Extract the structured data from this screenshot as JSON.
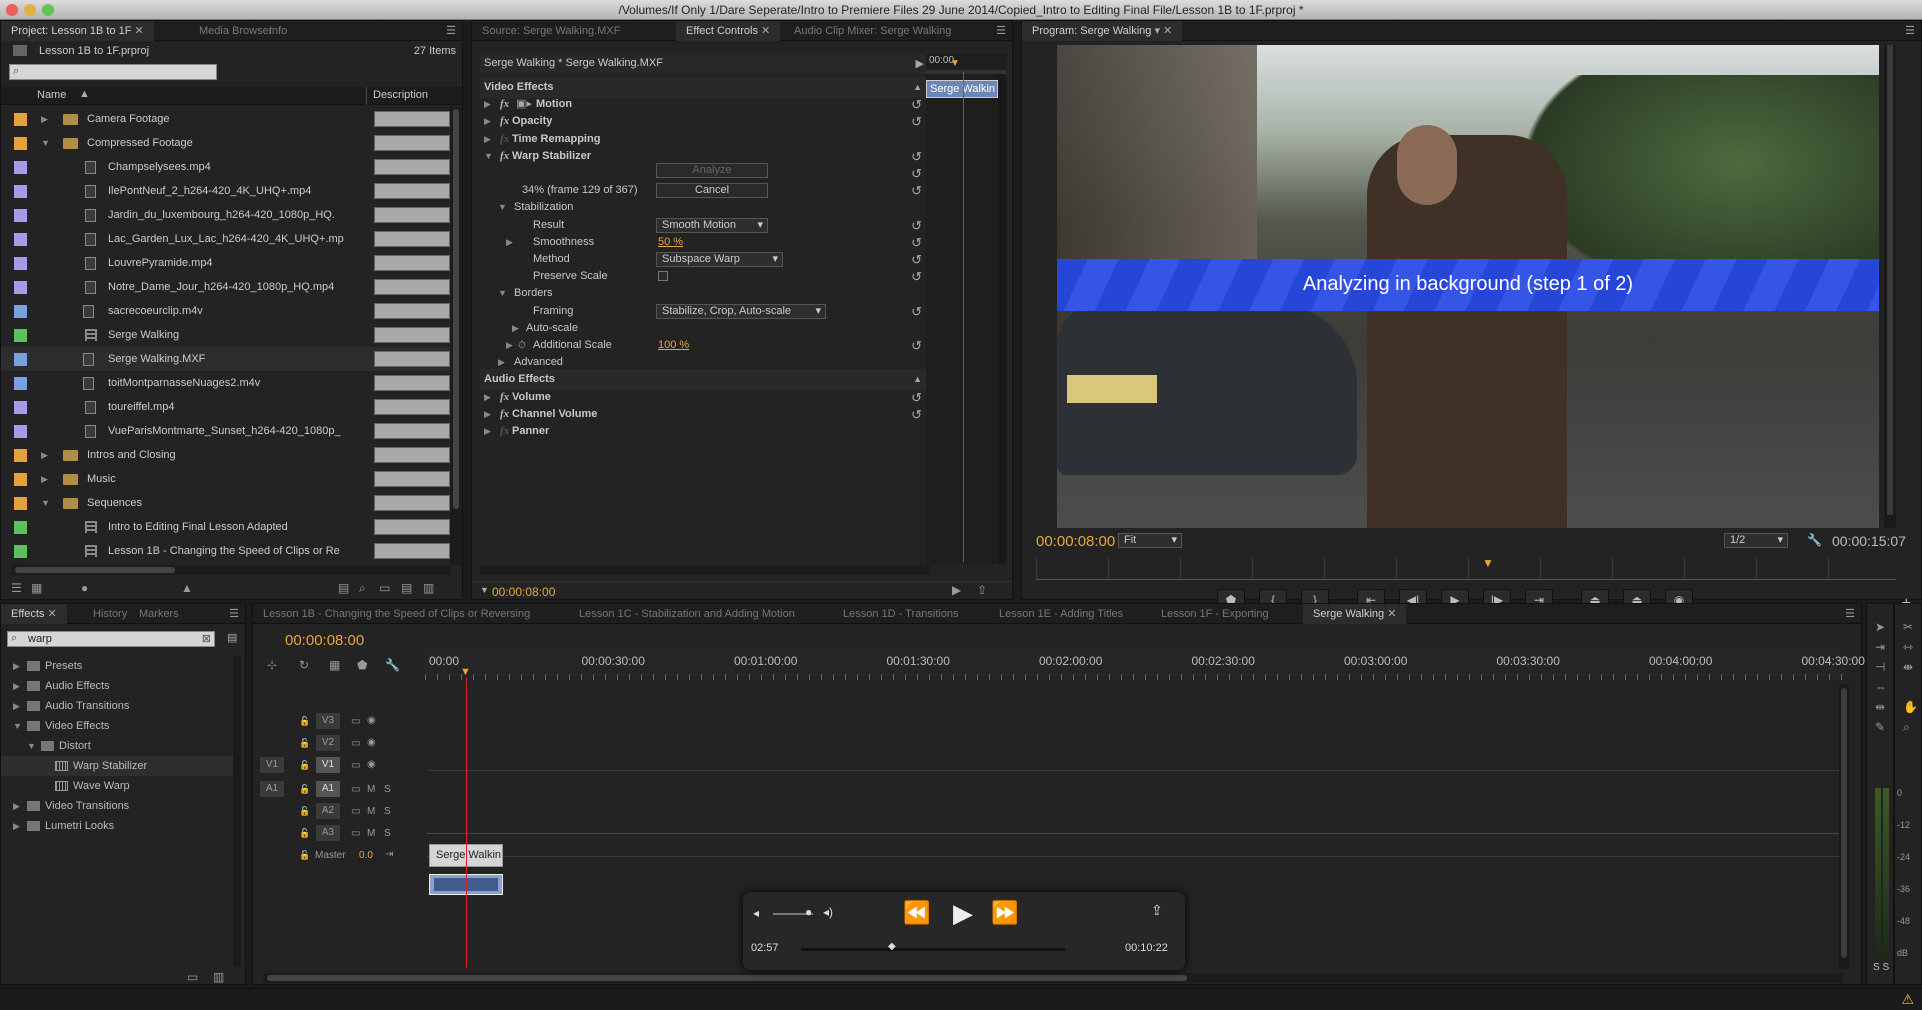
{
  "window": {
    "title": "/Volumes/If Only 1/Dare Seperate/Intro to Premiere Files 29 June 2014/Copied_Intro to Editing Final File/Lesson 1B to 1F.prproj *"
  },
  "project": {
    "tabs": [
      "Project: Lesson 1B to 1F",
      "Media Browser",
      "Info"
    ],
    "file": "Lesson 1B to 1F.prproj",
    "count": "27 Items",
    "col_name": "Name",
    "col_desc": "Description",
    "items": [
      {
        "name": "Camera Footage",
        "type": "folder",
        "indent": 0,
        "exp": "closed",
        "color": "#e3a33a"
      },
      {
        "name": "Compressed Footage",
        "type": "folder",
        "indent": 0,
        "exp": "open",
        "color": "#e3a33a"
      },
      {
        "name": "Champselysees.mp4",
        "type": "file",
        "indent": 1,
        "color": "#a79ae6"
      },
      {
        "name": "IlePontNeuf_2_h264-420_4K_UHQ+.mp4",
        "type": "file",
        "indent": 1,
        "color": "#a79ae6"
      },
      {
        "name": "Jardin_du_luxembourg_h264-420_1080p_HQ.",
        "type": "file",
        "indent": 1,
        "color": "#a79ae6"
      },
      {
        "name": "Lac_Garden_Lux_Lac_h264-420_4K_UHQ+.mp",
        "type": "file",
        "indent": 1,
        "color": "#a79ae6"
      },
      {
        "name": "LouvrePyramide.mp4",
        "type": "file",
        "indent": 1,
        "color": "#a79ae6"
      },
      {
        "name": "Notre_Dame_Jour_h264-420_1080p_HQ.mp4",
        "type": "file",
        "indent": 1,
        "color": "#a79ae6"
      },
      {
        "name": "sacrecoeurclip.m4v",
        "type": "clip",
        "indent": 1,
        "color": "#7aa0e0"
      },
      {
        "name": "Serge Walking",
        "type": "seq",
        "indent": 1,
        "color": "#5fbf5f"
      },
      {
        "name": "Serge Walking.MXF",
        "type": "clip",
        "indent": 1,
        "color": "#7aa0e0"
      },
      {
        "name": "toitMontparnasseNuages2.m4v",
        "type": "clip",
        "indent": 1,
        "color": "#7aa0e0"
      },
      {
        "name": "toureiffel.mp4",
        "type": "file",
        "indent": 1,
        "color": "#a79ae6"
      },
      {
        "name": "VueParisMontmarte_Sunset_h264-420_1080p_",
        "type": "file",
        "indent": 1,
        "color": "#a79ae6"
      },
      {
        "name": "Intros and Closing",
        "type": "folder",
        "indent": 0,
        "exp": "closed",
        "color": "#e3a33a"
      },
      {
        "name": "Music",
        "type": "folder",
        "indent": 0,
        "exp": "closed",
        "color": "#e3a33a"
      },
      {
        "name": "Sequences",
        "type": "folder",
        "indent": 0,
        "exp": "open",
        "color": "#e3a33a"
      },
      {
        "name": "Intro to Editing Final Lesson Adapted",
        "type": "seq",
        "indent": 1,
        "color": "#5fbf5f"
      },
      {
        "name": "Lesson 1B - Changing the Speed of Clips or Re",
        "type": "seq",
        "indent": 1,
        "color": "#5fbf5f"
      }
    ]
  },
  "effect_controls": {
    "tabs": [
      "Source: Serge Walking.MXF",
      "Effect Controls",
      "Audio Clip Mixer: Serge Walking"
    ],
    "clip_header": "Serge Walking * Serge Walking.MXF",
    "mini_time": "00:00",
    "mini_clip": "Serge Walkin",
    "video_effects": "Video Effects",
    "motion": "Motion",
    "opacity": "Opacity",
    "time_remap": "Time Remapping",
    "warp": "Warp Stabilizer",
    "analyze": "Analyze",
    "progress": "34% (frame 129 of 367)",
    "cancel": "Cancel",
    "stabilization": "Stabilization",
    "result_lbl": "Result",
    "result_val": "Smooth Motion",
    "smooth_lbl": "Smoothness",
    "smooth_val": "50 %",
    "method_lbl": "Method",
    "method_val": "Subspace Warp",
    "preserve": "Preserve Scale",
    "borders": "Borders",
    "framing_lbl": "Framing",
    "framing_val": "Stabilize, Crop, Auto-scale",
    "autoscale": "Auto-scale",
    "addscale_lbl": "Additional Scale",
    "addscale_val": "100 %",
    "advanced": "Advanced",
    "audio_effects": "Audio Effects",
    "volume": "Volume",
    "channel_volume": "Channel Volume",
    "panner": "Panner",
    "timecode": "00:00:08:00"
  },
  "program": {
    "tab": "Program: Serge Walking",
    "banner": "Analyzing in background (step 1 of 2)",
    "timecode": "00:00:08:00",
    "fit": "Fit",
    "res": "1/2",
    "duration": "00:00:15:07"
  },
  "effects": {
    "tabs": [
      "Effects",
      "History",
      "Markers"
    ],
    "search": "warp",
    "items": [
      {
        "label": "Presets",
        "indent": 0,
        "exp": "closed",
        "kind": "folder"
      },
      {
        "label": "Audio Effects",
        "indent": 0,
        "exp": "closed",
        "kind": "folder"
      },
      {
        "label": "Audio Transitions",
        "indent": 0,
        "exp": "closed",
        "kind": "folder"
      },
      {
        "label": "Video Effects",
        "indent": 0,
        "exp": "open",
        "kind": "folder"
      },
      {
        "label": "Distort",
        "indent": 1,
        "exp": "open",
        "kind": "folder"
      },
      {
        "label": "Warp Stabilizer",
        "indent": 2,
        "exp": "none",
        "kind": "effect"
      },
      {
        "label": "Wave Warp",
        "indent": 2,
        "exp": "none",
        "kind": "effect"
      },
      {
        "label": "Video Transitions",
        "indent": 0,
        "exp": "closed",
        "kind": "folder"
      },
      {
        "label": "Lumetri Looks",
        "indent": 0,
        "exp": "closed",
        "kind": "folder"
      }
    ]
  },
  "timeline": {
    "tabs": [
      "Lesson 1B - Changing the Speed of Clips or Reversing",
      "Lesson 1C - Stabilization and Adding Motion",
      "Lesson 1D - Transitions",
      "Lesson 1E - Adding Titles",
      "Lesson 1F - Exporting",
      "Serge Walking"
    ],
    "timecode": "00:00:08:00",
    "ruler": [
      "00:00",
      "00:00:30:00",
      "00:01:00:00",
      "00:01:30:00",
      "00:02:00:00",
      "00:02:30:00",
      "00:03:00:00",
      "00:03:30:00",
      "00:04:00:00",
      "00:04:30:00"
    ],
    "clip": "Serge Walkin",
    "tracks": [
      "V3",
      "V2",
      "V1",
      "A1",
      "A2",
      "A3"
    ],
    "src_v": "V1",
    "src_a": "A1",
    "master": "Master",
    "master_val": "0.0",
    "m": "M",
    "s": "S"
  },
  "player": {
    "elapsed": "02:57",
    "remaining": "00:10:22"
  },
  "meter": {
    "ticks": [
      "0",
      "-12",
      "-24",
      "-36",
      "-48",
      "dB"
    ],
    "solo": "S S"
  }
}
